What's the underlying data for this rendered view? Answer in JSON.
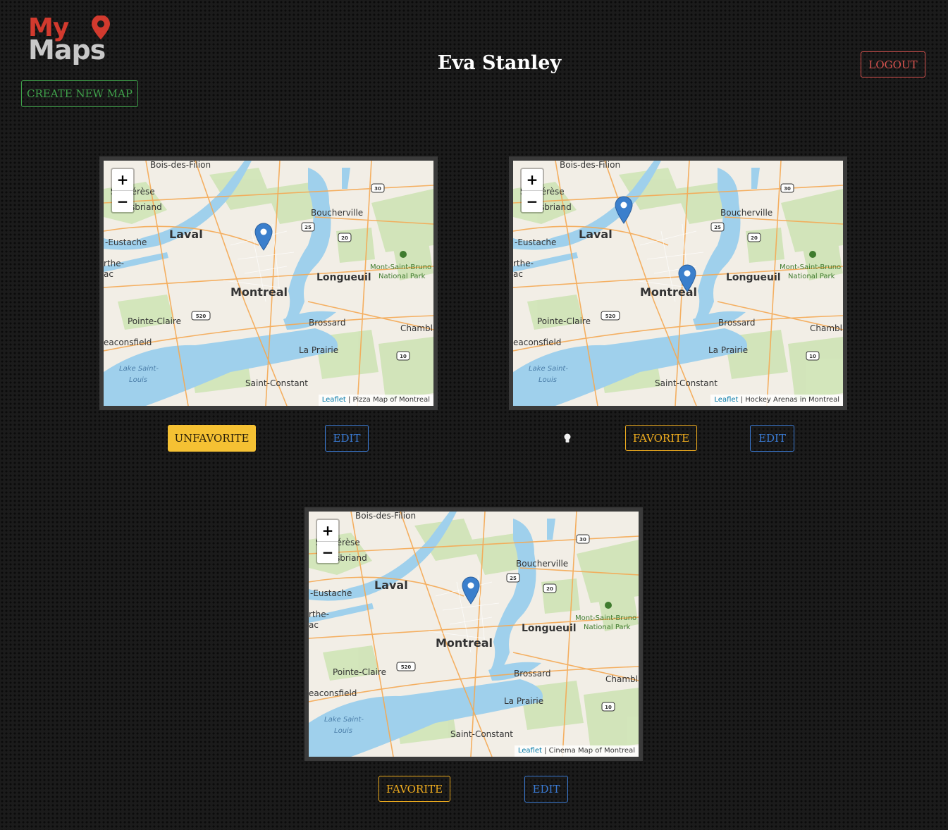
{
  "logo": {
    "line1": "My",
    "line2": "Maps"
  },
  "header": {
    "user_name": "Eva Stanley",
    "logout_label": "LOGOUT",
    "create_label": "CREATE NEW MAP"
  },
  "map_common": {
    "zoom_in": "+",
    "zoom_out": "−",
    "attribution_link": "Leaflet",
    "separator": " | ",
    "places": {
      "bois": "Bois-des-Filion",
      "therese": "S  -Thérèse",
      "briand": "sbriand",
      "laval": "Laval",
      "eustache": "-Eustache",
      "rthe": "rthe-",
      "ac": "ac",
      "boucherville": "Boucherville",
      "montreal": "Montreal",
      "longueuil": "Longueuil",
      "msb1": "Mont-Saint-Bruno",
      "msb2": "National Park",
      "pointe": "Pointe-Claire",
      "beacons": "eaconsfield",
      "brossard": "Brossard",
      "chambly": "Chambl",
      "laprairie": "La Prairie",
      "lake1": "Lake Saint-",
      "lake2": "Louis",
      "saintconstant": "Saint-Constant",
      "r30": "30",
      "r25": "25",
      "r20": "20",
      "r520": "520",
      "r10": "10"
    }
  },
  "maps": [
    {
      "attribution_title": "Pizza Map of Montreal",
      "fav_label": "UNFAVORITE"
    },
    {
      "attribution_title": "Hockey Arenas in Montreal",
      "fav_label": "FAVORITE"
    },
    {
      "attribution_title": "Cinema Map of Montreal",
      "fav_label": "FAVORITE"
    }
  ],
  "edit_label": "EDIT",
  "colors": {
    "water": "#9fd0ec",
    "land": "#f2eee6",
    "road": "#f5a953",
    "park": "#c9e0b0",
    "marker": "#3b7fcc",
    "favorite": "#f0ad1e",
    "edit": "#3a7bd5",
    "logout": "#d9534f",
    "create": "#3fa14a"
  }
}
